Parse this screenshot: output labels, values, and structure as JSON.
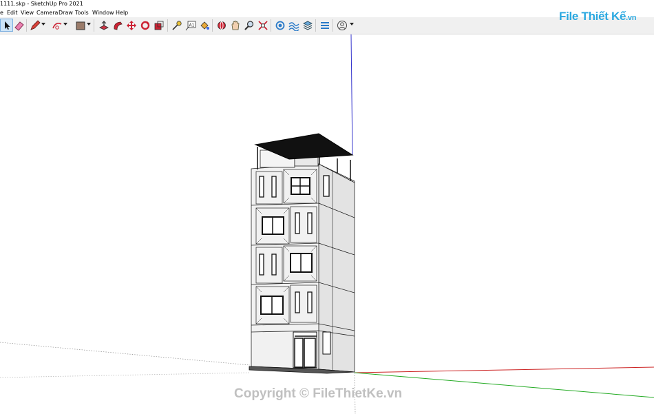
{
  "window": {
    "title": "1111.skp - SketchUp Pro 2021"
  },
  "menu": [
    {
      "label": "e"
    },
    {
      "label": "Edit"
    },
    {
      "label": "View"
    },
    {
      "label": "Camera"
    },
    {
      "label": "Draw"
    },
    {
      "label": "Tools"
    },
    {
      "label": "Window"
    },
    {
      "label": "Help"
    }
  ],
  "toolbar": {
    "tools": [
      "select-icon",
      "eraser-icon",
      "pencil-icon",
      "arc-icon",
      "rectangle-icon",
      "push-pull-icon",
      "follow-me-icon",
      "move-icon",
      "rotate-icon",
      "scale-icon",
      "tape-measure-icon",
      "text-icon",
      "paint-bucket-icon",
      "orbit-icon",
      "pan-icon",
      "zoom-icon",
      "zoom-extents-icon",
      "section-icon",
      "sandbox-icon",
      "layers-icon",
      "styles-icon",
      "user-icon"
    ]
  },
  "logo": {
    "main": "File Thiết Kế",
    "suffix": ".vn"
  },
  "watermark": {
    "text": "Copyright © FileThietKe.vn"
  },
  "colors": {
    "red_axis": "#cc2222",
    "green_axis": "#22aa22",
    "blue_axis": "#3333cc",
    "brand": "#2aa8e0"
  }
}
